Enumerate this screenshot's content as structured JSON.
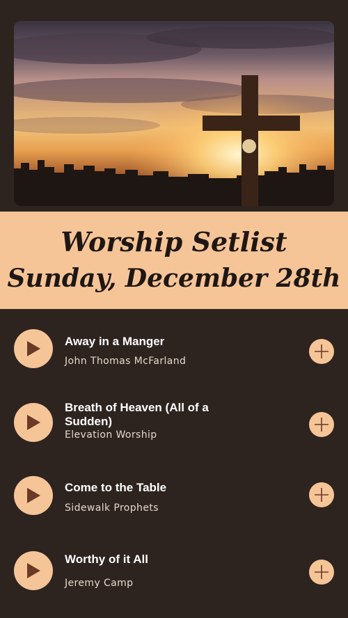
{
  "header": {
    "title_line1": "Worship Setlist",
    "title_line2": "Sunday, December 28th"
  },
  "hero_image": {
    "subject": "cross-at-sunset-image"
  },
  "songs": [
    {
      "title": "Away in a Manger",
      "artist": "John Thomas McFarland"
    },
    {
      "title": "Breath of Heaven (All of a Sudden)",
      "artist": "Elevation Worship"
    },
    {
      "title": "Come to the Table",
      "artist": "Sidewalk Prophets"
    },
    {
      "title": "Worthy of it All",
      "artist": "Jeremy Camp"
    }
  ],
  "icons": {
    "play": "play-icon",
    "add": "plus-icon"
  },
  "colors": {
    "background": "#2d2420",
    "accent": "#f6c597",
    "icon": "#6a3a26"
  }
}
